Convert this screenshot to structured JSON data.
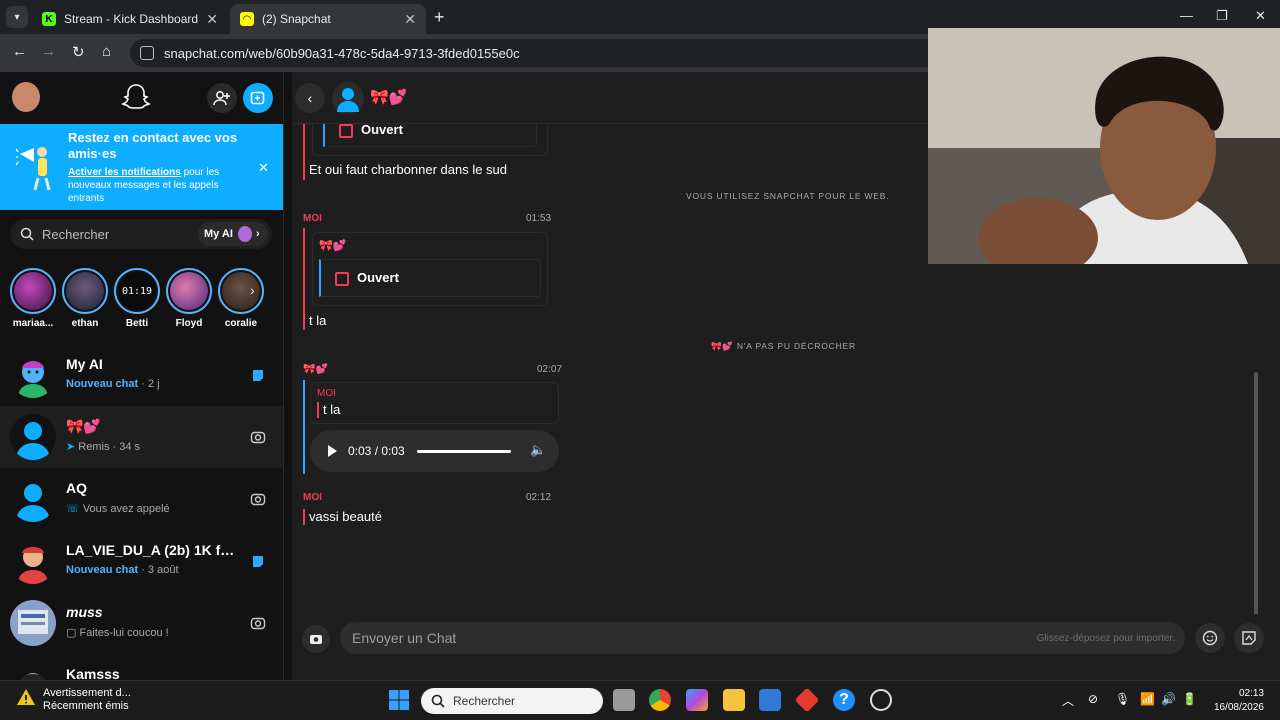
{
  "browser": {
    "tabs": [
      {
        "title": "Stream - Kick Dashboard",
        "active": false
      },
      {
        "title": "(2) Snapchat",
        "active": true
      }
    ],
    "url": "snapchat.com/web/60b90a31-478c-5da4-9713-3fded0155e0c"
  },
  "sidebar": {
    "banner": {
      "heading": "Restez en contact avec vos amis·es",
      "link": "Activer les notifications",
      "body": " pour les nouveaux messages et les appels entrants"
    },
    "search_placeholder": "Rechercher",
    "myai_label": "My AI",
    "stories": [
      {
        "name": "mariaa...",
        "color": "#7a2d7a"
      },
      {
        "name": "ethan",
        "color": "#2a3b5a"
      },
      {
        "name": "Betti",
        "color": "#111111"
      },
      {
        "name": "Floyd",
        "color": "#b04a7a"
      },
      {
        "name": "coralie",
        "color": "#3a2c25"
      }
    ],
    "story_clock": "01:19",
    "chats": [
      {
        "name": "My AI",
        "status": "Nouveau chat",
        "time": "2 j",
        "type": "new"
      },
      {
        "name": "🎀💕",
        "status": "Remis",
        "time": "34 s",
        "type": "sent"
      },
      {
        "name": "AQ",
        "status": "Vous avez appelé",
        "time": "",
        "type": "call"
      },
      {
        "name": "LA_VIE_DU_A (2b) 1K fol...",
        "status": "Nouveau chat",
        "time": "3 août",
        "type": "new"
      },
      {
        "name": "muss",
        "status": "Faites-lui coucou !",
        "time": "",
        "type": "wave"
      },
      {
        "name": "Kamsss",
        "status": "",
        "time": "",
        "type": "none"
      }
    ]
  },
  "chat": {
    "header_name": "🎀💕",
    "messages": {
      "quote1_text": "Ouvert",
      "msg1": "Et oui faut charbonner dans le sud",
      "sys1": "VOUS UTILISEZ SNAPCHAT POUR LE WEB.",
      "moi_label": "MOI",
      "time1": "01:53",
      "reply_sender": "🎀💕",
      "quote2_text": "Ouvert",
      "msg2": "t la",
      "sys2": "🎀💕 N'A PAS PU DÉCROCHER",
      "other_label": "🎀💕",
      "time2": "02:07",
      "quote3_sender": "MOI",
      "quote3_text": "t la",
      "audio_time": "0:03 / 0:03",
      "time3": "02:12",
      "msg3": "vassi beauté"
    },
    "composer_placeholder": "Envoyer un Chat",
    "composer_hint": "Glissez-déposez pour importer."
  },
  "taskbar": {
    "warning_title": "Avertissement d...",
    "warning_sub": "Récemment émis",
    "search_placeholder": "Rechercher",
    "time": "02:13",
    "date": "16/08/2026"
  }
}
